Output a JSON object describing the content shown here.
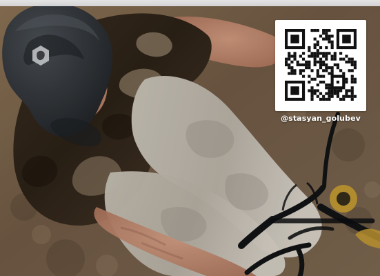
{
  "overlay": {
    "social_handle": "@stasyan_golubev",
    "qr_code_icon": "qr-code-icon"
  },
  "colors": {
    "dirt": "#7a6650",
    "shirt_dark": "#2b2116",
    "shirt_light": "#a28e77",
    "pants": "#c7c1b7",
    "helmet": "#2a2d30",
    "skin": "#c98f74",
    "bike_black": "#121314",
    "bike_gold": "#c59b33",
    "qr_bg": "#ffffff",
    "qr_dark": "#111111",
    "label_text": "#ffffff"
  }
}
